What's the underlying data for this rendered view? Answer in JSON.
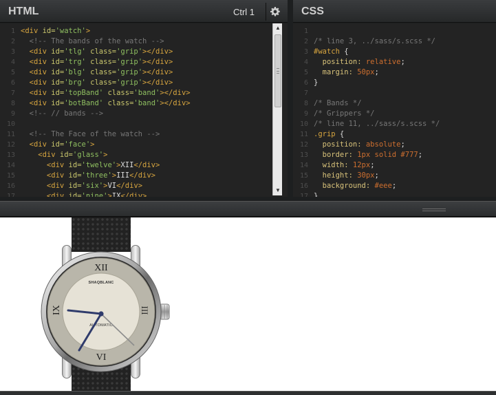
{
  "html_pane": {
    "title": "HTML",
    "shortcut": "Ctrl 1",
    "settings_icon": "gear-icon",
    "lines": [
      [
        [
          "tag",
          "<div "
        ],
        [
          "attr",
          "id="
        ],
        [
          "str",
          "'watch'"
        ],
        [
          "tag",
          ">"
        ]
      ],
      [
        [
          "cmt",
          "  <!-- The bands of the watch -->"
        ]
      ],
      [
        [
          "tag",
          "  <div "
        ],
        [
          "attr",
          "id="
        ],
        [
          "str",
          "'tlg'"
        ],
        [
          "attr",
          " class="
        ],
        [
          "str",
          "'grip'"
        ],
        [
          "tag",
          "></div>"
        ]
      ],
      [
        [
          "tag",
          "  <div "
        ],
        [
          "attr",
          "id="
        ],
        [
          "str",
          "'trg'"
        ],
        [
          "attr",
          " class="
        ],
        [
          "str",
          "'grip'"
        ],
        [
          "tag",
          "></div>"
        ]
      ],
      [
        [
          "tag",
          "  <div "
        ],
        [
          "attr",
          "id="
        ],
        [
          "str",
          "'blg'"
        ],
        [
          "attr",
          " class="
        ],
        [
          "str",
          "'grip'"
        ],
        [
          "tag",
          "></div>"
        ]
      ],
      [
        [
          "tag",
          "  <div "
        ],
        [
          "attr",
          "id="
        ],
        [
          "str",
          "'brg'"
        ],
        [
          "attr",
          " class="
        ],
        [
          "str",
          "'grip'"
        ],
        [
          "tag",
          "></div>"
        ]
      ],
      [
        [
          "tag",
          "  <div "
        ],
        [
          "attr",
          "id="
        ],
        [
          "str",
          "'topBand'"
        ],
        [
          "attr",
          " class="
        ],
        [
          "str",
          "'band'"
        ],
        [
          "tag",
          "></div>"
        ]
      ],
      [
        [
          "tag",
          "  <div "
        ],
        [
          "attr",
          "id="
        ],
        [
          "str",
          "'botBand'"
        ],
        [
          "attr",
          " class="
        ],
        [
          "str",
          "'band'"
        ],
        [
          "tag",
          "></div>"
        ]
      ],
      [
        [
          "cmt",
          "  <!-- // bands -->"
        ]
      ],
      [
        [
          "txt",
          ""
        ]
      ],
      [
        [
          "cmt",
          "  <!-- The Face of the watch -->"
        ]
      ],
      [
        [
          "tag",
          "  <div "
        ],
        [
          "attr",
          "id="
        ],
        [
          "str",
          "'face'"
        ],
        [
          "tag",
          ">"
        ]
      ],
      [
        [
          "tag",
          "    <div "
        ],
        [
          "attr",
          "id="
        ],
        [
          "str",
          "'glass'"
        ],
        [
          "tag",
          ">"
        ]
      ],
      [
        [
          "tag",
          "      <div "
        ],
        [
          "attr",
          "id="
        ],
        [
          "str",
          "'twelve'"
        ],
        [
          "tag",
          ">"
        ],
        [
          "txt",
          "XII"
        ],
        [
          "tag",
          "</div>"
        ]
      ],
      [
        [
          "tag",
          "      <div "
        ],
        [
          "attr",
          "id="
        ],
        [
          "str",
          "'three'"
        ],
        [
          "tag",
          ">"
        ],
        [
          "txt",
          "III"
        ],
        [
          "tag",
          "</div>"
        ]
      ],
      [
        [
          "tag",
          "      <div "
        ],
        [
          "attr",
          "id="
        ],
        [
          "str",
          "'six'"
        ],
        [
          "tag",
          ">"
        ],
        [
          "txt",
          "VI"
        ],
        [
          "tag",
          "</div>"
        ]
      ],
      [
        [
          "tag",
          "      <div "
        ],
        [
          "attr",
          "id="
        ],
        [
          "str",
          "'nine'"
        ],
        [
          "tag",
          ">"
        ],
        [
          "txt",
          "IX"
        ],
        [
          "tag",
          "</div>"
        ]
      ]
    ]
  },
  "css_pane": {
    "title": "CSS",
    "lines": [
      [
        [
          "txt",
          ""
        ]
      ],
      [
        [
          "cmt",
          "/* line 3, ../sass/s.scss */"
        ]
      ],
      [
        [
          "sel",
          "#watch"
        ],
        [
          "pun",
          " {"
        ]
      ],
      [
        [
          "prop",
          "  position: "
        ],
        [
          "val",
          "relative"
        ],
        [
          "pun",
          ";"
        ]
      ],
      [
        [
          "prop",
          "  margin: "
        ],
        [
          "val",
          "50px"
        ],
        [
          "pun",
          ";"
        ]
      ],
      [
        [
          "pun",
          "}"
        ]
      ],
      [
        [
          "txt",
          ""
        ]
      ],
      [
        [
          "cmt",
          "/* Bands */"
        ]
      ],
      [
        [
          "cmt",
          "/* Grippers */"
        ]
      ],
      [
        [
          "cmt",
          "/* line 11, ../sass/s.scss */"
        ]
      ],
      [
        [
          "sel",
          ".grip"
        ],
        [
          "pun",
          " {"
        ]
      ],
      [
        [
          "prop",
          "  position: "
        ],
        [
          "val",
          "absolute"
        ],
        [
          "pun",
          ";"
        ]
      ],
      [
        [
          "prop",
          "  border: "
        ],
        [
          "val",
          "1px solid #777"
        ],
        [
          "pun",
          ";"
        ]
      ],
      [
        [
          "prop",
          "  width: "
        ],
        [
          "val",
          "12px"
        ],
        [
          "pun",
          ";"
        ]
      ],
      [
        [
          "prop",
          "  height: "
        ],
        [
          "val",
          "30px"
        ],
        [
          "pun",
          ";"
        ]
      ],
      [
        [
          "prop",
          "  background: "
        ],
        [
          "val",
          "#eee"
        ],
        [
          "pun",
          ";"
        ]
      ],
      [
        [
          "pun",
          "}"
        ]
      ]
    ]
  },
  "preview": {
    "brand": "SHAQBLANC",
    "movement": "AUTOMATIC",
    "numerals": {
      "twelve": "XII",
      "three": "III",
      "six": "VI",
      "nine": "IX"
    }
  },
  "colors": {
    "editor_bg": "#232323",
    "header_bg": "#2f3132",
    "dial_outer": "#b9b6aa",
    "dial_inner": "#e6e2d6",
    "hand": "#2f3b6b"
  }
}
